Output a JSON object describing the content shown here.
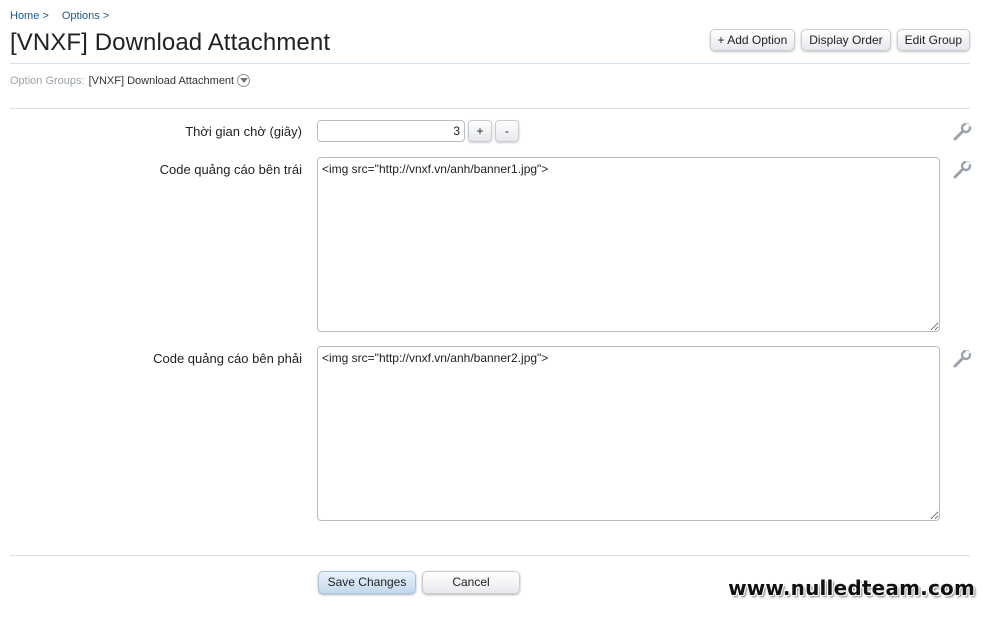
{
  "breadcrumb": [
    {
      "label": "Home",
      "sep": ">"
    },
    {
      "label": "Options",
      "sep": ">"
    }
  ],
  "page": {
    "title": "[VNXF] Download Attachment"
  },
  "top_actions": {
    "add_option": "+ Add Option",
    "display_order": "Display Order",
    "edit_group": "Edit Group"
  },
  "option_groups": {
    "label": "Option Groups:",
    "value": "[VNXF] Download Attachment"
  },
  "fields": {
    "wait_time": {
      "label": "Thời gian chờ (giây)",
      "value": "3",
      "plus": "+",
      "minus": "-"
    },
    "ad_left": {
      "label": "Code quảng cáo bên trái",
      "value": "<img src=\"http://vnxf.vn/anh/banner1.jpg\">"
    },
    "ad_right": {
      "label": "Code quảng cáo bên phải",
      "value": "<img src=\"http://vnxf.vn/anh/banner2.jpg\">"
    }
  },
  "bottom_actions": {
    "save": "Save Changes",
    "cancel": "Cancel"
  },
  "watermark": "www.nulledteam.com",
  "icons": {
    "edit": "wrench-icon",
    "dropdown": "chevron-down-icon"
  },
  "colors": {
    "link": "#1c5a8c",
    "rule": "#d5e2ee",
    "primary_button": "#c3d9ee"
  }
}
